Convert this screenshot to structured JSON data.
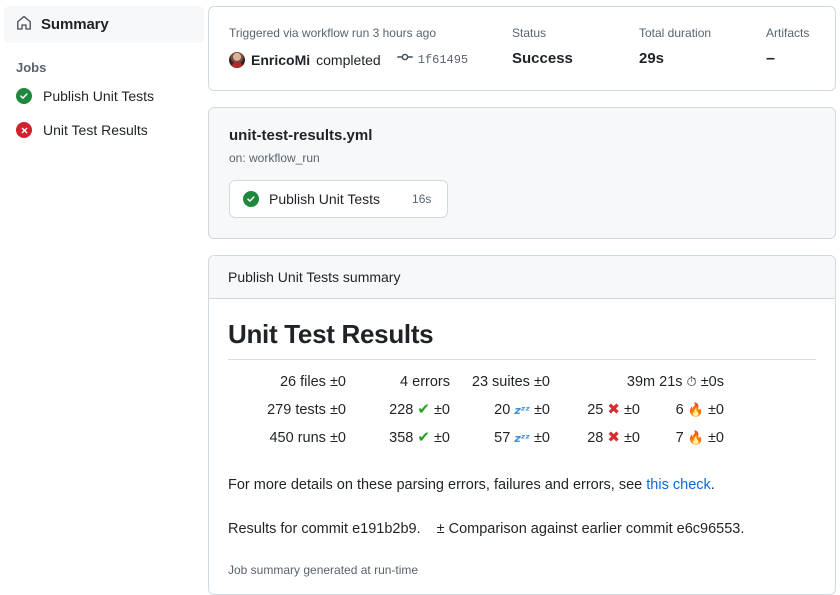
{
  "sidebar": {
    "summary": {
      "label": "Summary",
      "icon": "home-icon"
    },
    "jobs_heading": "Jobs",
    "jobs": [
      {
        "label": "Publish Unit Tests",
        "status": "success",
        "icon": "check-circle-icon"
      },
      {
        "label": "Unit Test Results",
        "status": "failure",
        "icon": "x-circle-icon"
      }
    ]
  },
  "run_header": {
    "trigger_label": "Triggered via workflow run 3 hours ago",
    "actor": "EnricoMi",
    "actor_action": "completed",
    "commit_sha": "1f61495",
    "commit_icon": "git-commit-icon",
    "status_label": "Status",
    "status_value": "Success",
    "duration_label": "Total duration",
    "duration_value": "29s",
    "artifacts_label": "Artifacts",
    "artifacts_value": "–"
  },
  "workflow": {
    "file_name": "unit-test-results.yml",
    "trigger": "on: workflow_run",
    "job": {
      "name": "Publish Unit Tests",
      "duration": "16s",
      "status": "success",
      "icon": "check-circle-icon"
    }
  },
  "summary_panel": {
    "header": "Publish Unit Tests summary",
    "title": "Unit Test Results",
    "stats": {
      "rows": [
        [
          {
            "value": "26",
            "unit": "files",
            "emoji": "",
            "delta": "±0"
          },
          {
            "value": "4",
            "unit": "errors",
            "emoji": "",
            "delta": ""
          },
          {
            "value": "23",
            "unit": "suites",
            "emoji": "",
            "delta": "±0"
          },
          {
            "value": "39m 21s",
            "unit": "",
            "emoji": "⏱",
            "delta": "±0s"
          },
          {
            "value": "",
            "unit": "",
            "emoji": "",
            "delta": ""
          }
        ],
        [
          {
            "value": "279",
            "unit": "tests",
            "emoji": "",
            "delta": "±0"
          },
          {
            "value": "228",
            "unit": "",
            "emoji": "✔",
            "delta": "±0"
          },
          {
            "value": "20",
            "unit": "",
            "emoji": "zᶻᶻ",
            "delta": "±0"
          },
          {
            "value": "25",
            "unit": "",
            "emoji": "✖",
            "delta": "±0"
          },
          {
            "value": "6",
            "unit": "",
            "emoji": "🔥",
            "delta": "±0"
          }
        ],
        [
          {
            "value": "450",
            "unit": "runs",
            "emoji": "",
            "delta": "±0"
          },
          {
            "value": "358",
            "unit": "",
            "emoji": "✔",
            "delta": "±0"
          },
          {
            "value": "57",
            "unit": "",
            "emoji": "zᶻᶻ",
            "delta": "±0"
          },
          {
            "value": "28",
            "unit": "",
            "emoji": "✖",
            "delta": "±0"
          },
          {
            "value": "7",
            "unit": "",
            "emoji": "🔥",
            "delta": "±0"
          }
        ]
      ]
    },
    "details_text_before": "For more details on these parsing errors, failures and errors, see ",
    "details_link": "this check",
    "details_text_after": ".",
    "results_commit": "Results for commit e191b2b9.",
    "comparison_text": "± Comparison against earlier commit e6c96553.",
    "footer": "Job summary generated at run-time"
  },
  "colors": {
    "success": "#1f883d",
    "failure": "#cf222e",
    "link": "#0969da",
    "muted": "#59636e",
    "panel_bg": "#f6f8fa",
    "border": "#d1d9e0"
  }
}
